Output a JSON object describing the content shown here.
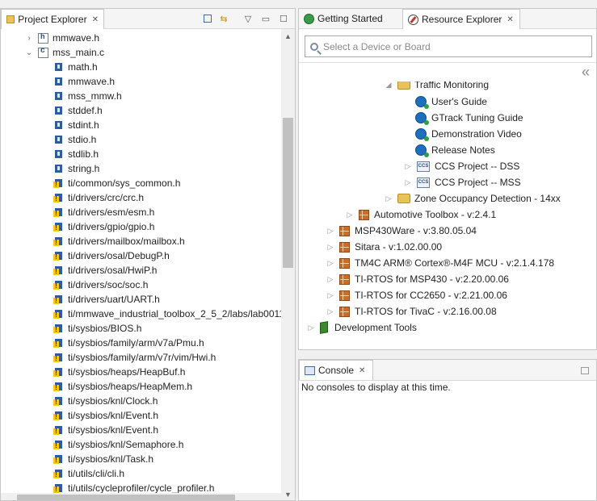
{
  "project_explorer": {
    "title": "Project Explorer",
    "items": [
      {
        "label": "mmwave.h",
        "kind": "hfile"
      },
      {
        "label": "mss_main.c",
        "kind": "cfile"
      },
      {
        "label": "math.h",
        "kind": "include"
      },
      {
        "label": "mmwave.h",
        "kind": "include"
      },
      {
        "label": "mss_mmw.h",
        "kind": "include"
      },
      {
        "label": "stddef.h",
        "kind": "include"
      },
      {
        "label": "stdint.h",
        "kind": "include"
      },
      {
        "label": "stdio.h",
        "kind": "include"
      },
      {
        "label": "stdlib.h",
        "kind": "include"
      },
      {
        "label": "string.h",
        "kind": "include"
      },
      {
        "label": "ti/common/sys_common.h",
        "kind": "warn"
      },
      {
        "label": "ti/drivers/crc/crc.h",
        "kind": "warn"
      },
      {
        "label": "ti/drivers/esm/esm.h",
        "kind": "warn"
      },
      {
        "label": "ti/drivers/gpio/gpio.h",
        "kind": "warn"
      },
      {
        "label": "ti/drivers/mailbox/mailbox.h",
        "kind": "warn"
      },
      {
        "label": "ti/drivers/osal/DebugP.h",
        "kind": "warn"
      },
      {
        "label": "ti/drivers/osal/HwiP.h",
        "kind": "warn"
      },
      {
        "label": "ti/drivers/soc/soc.h",
        "kind": "warn"
      },
      {
        "label": "ti/drivers/uart/UART.h",
        "kind": "warn"
      },
      {
        "label": "ti/mmwave_industrial_toolbox_2_5_2/labs/lab0011",
        "kind": "warn"
      },
      {
        "label": "ti/sysbios/BIOS.h",
        "kind": "warn"
      },
      {
        "label": "ti/sysbios/family/arm/v7a/Pmu.h",
        "kind": "warn"
      },
      {
        "label": "ti/sysbios/family/arm/v7r/vim/Hwi.h",
        "kind": "warn"
      },
      {
        "label": "ti/sysbios/heaps/HeapBuf.h",
        "kind": "warn"
      },
      {
        "label": "ti/sysbios/heaps/HeapMem.h",
        "kind": "warn"
      },
      {
        "label": "ti/sysbios/knl/Clock.h",
        "kind": "warn"
      },
      {
        "label": "ti/sysbios/knl/Event.h",
        "kind": "warn"
      },
      {
        "label": "ti/sysbios/knl/Event.h",
        "kind": "warn"
      },
      {
        "label": "ti/sysbios/knl/Semaphore.h",
        "kind": "warn"
      },
      {
        "label": "ti/sysbios/knl/Task.h",
        "kind": "warn"
      },
      {
        "label": "ti/utils/cli/cli.h",
        "kind": "warn"
      },
      {
        "label": "ti/utils/cycleprofiler/cycle_profiler.h",
        "kind": "warn"
      }
    ]
  },
  "tabs": {
    "getting_started": "Getting Started",
    "resource_explorer": "Resource Explorer"
  },
  "search": {
    "placeholder": "Select a Device or Board"
  },
  "resource_tree": [
    {
      "label": "Traffic Monitoring",
      "kind": "folder-open"
    },
    {
      "label": "User's Guide",
      "kind": "doc"
    },
    {
      "label": "GTrack Tuning Guide",
      "kind": "doc"
    },
    {
      "label": "Demonstration Video",
      "kind": "doc"
    },
    {
      "label": "Release Notes",
      "kind": "doc"
    },
    {
      "label": "CCS Project -- DSS",
      "kind": "ccs"
    },
    {
      "label": "CCS Project -- MSS",
      "kind": "ccs"
    },
    {
      "label": "Zone Occupancy Detection - 14xx",
      "kind": "folder"
    },
    {
      "label": "Automotive Toolbox - v:2.4.1",
      "kind": "pkg"
    },
    {
      "label": "MSP430Ware - v:3.80.05.04",
      "kind": "pkg"
    },
    {
      "label": "Sitara - v:1.02.00.00",
      "kind": "pkg"
    },
    {
      "label": "TM4C ARM® Cortex®-M4F MCU - v:2.1.4.178",
      "kind": "pkg"
    },
    {
      "label": "TI-RTOS for MSP430 - v:2.20.00.06",
      "kind": "pkg"
    },
    {
      "label": "TI-RTOS for CC2650 - v:2.21.00.06",
      "kind": "pkg"
    },
    {
      "label": "TI-RTOS for TivaC - v:2.16.00.08",
      "kind": "pkg"
    },
    {
      "label": "Development Tools",
      "kind": "devtools"
    }
  ],
  "console": {
    "title": "Console",
    "message": "No consoles to display at this time."
  }
}
